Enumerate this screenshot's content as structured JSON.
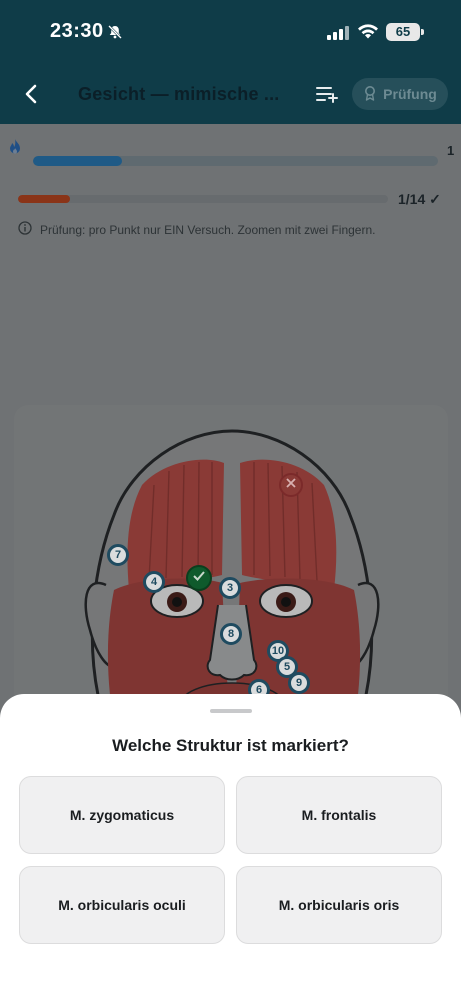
{
  "status_bar": {
    "time": "23:30",
    "battery": "65"
  },
  "nav": {
    "title": "Gesicht — mimische ...",
    "exam_label": "Prüfung"
  },
  "streak": {
    "count": "1",
    "progress_fraction": 0.22
  },
  "progress": {
    "label": "1/14 ✓",
    "fraction": 0.14
  },
  "hint": "Prüfung: pro Punkt nur EIN Versuch. Zoomen mit zwei Fingern.",
  "markers": [
    "7",
    "4",
    "3",
    "8",
    "10",
    "5",
    "9",
    "6"
  ],
  "question": "Welche Struktur ist markiert?",
  "answers": [
    "M. zygomaticus",
    "M. frontalis",
    "M. orbicularis oculi",
    "M. orbicularis oris"
  ],
  "colors": {
    "header": "#0f3c48",
    "muscle": "#c2413b",
    "marker": "#2b7fa6",
    "correct": "#1e9a4a",
    "wrong": "#d54040"
  }
}
